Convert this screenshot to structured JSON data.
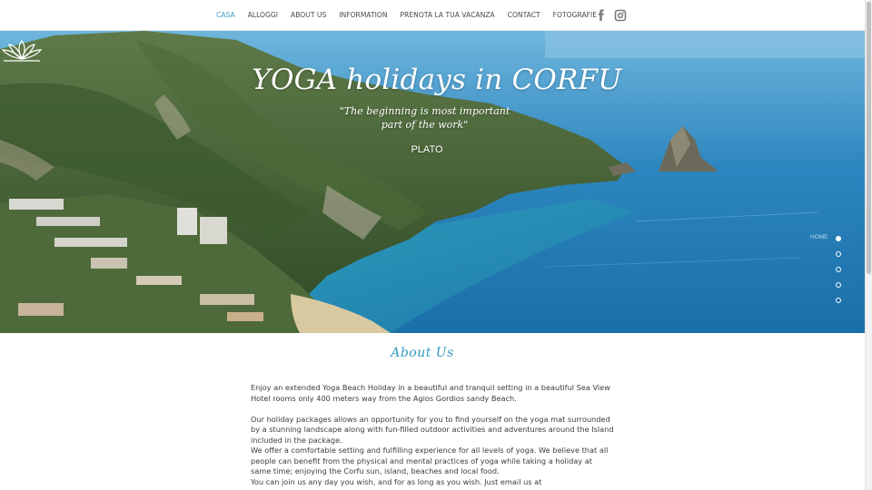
{
  "nav": {
    "items": [
      {
        "label": "CASA",
        "active": true
      },
      {
        "label": "ALLOGGI",
        "active": false
      },
      {
        "label": "ABOUT US",
        "active": false
      },
      {
        "label": "INFORMATION",
        "active": false
      },
      {
        "label": "PRENOTA LA TUA VACANZA",
        "active": false
      },
      {
        "label": "CONTACT",
        "active": false
      },
      {
        "label": "FOTOGRAFIE",
        "active": false
      }
    ],
    "social": [
      "facebook-icon",
      "instagram-icon"
    ],
    "active_color": "#3aa0c2"
  },
  "hero": {
    "title": "YOGA holidays in CORFU",
    "quote_line1": "\"The beginning is most important",
    "quote_line2": "part of the work\"",
    "author": "PLATO",
    "logo": "lotus-icon"
  },
  "side_nav": {
    "label": "HOME",
    "dots": 5,
    "active_index": 0
  },
  "about": {
    "title": "About Us",
    "paragraph1": " Enjoy an extended Yoga  Beach Holiday  in a beautiful and tranquil setting  in a beautiful Sea View Hotel rooms  only 400 meters way from the Agios Gordios sandy Beach.",
    "paragraph2": "Our holiday packages allows an opportunity for you to find yourself on the yoga mat surrounded by a stunning landscape along with fun-filled outdoor activities and adventures around the Island included in the package.",
    "paragraph3": " We offer a comfortable setting and fulfilling experience for all levels of yoga. We believe that all people can benefit from the physical and mental practices of yoga while taking a holiday at same time; enjoying the Corfu sun, island, beaches and local food.",
    "paragraph4": "You can join us any day you wish,  and for as long as you wish. Just  email us  at",
    "title_color": "#2f99be"
  }
}
